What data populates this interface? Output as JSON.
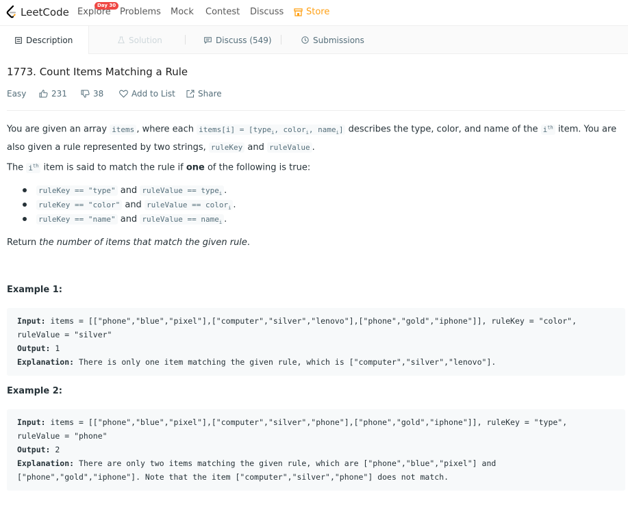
{
  "nav": {
    "logo": "LeetCode",
    "explore": "Explore",
    "badge": "Day 30",
    "problems": "Problems",
    "mock": "Mock",
    "contest": "Contest",
    "discuss": "Discuss",
    "store": "Store",
    "accent": "#ffa116"
  },
  "tabs": {
    "description": "Description",
    "solution": "Solution",
    "discuss": "Discuss (549)",
    "submissions": "Submissions"
  },
  "problem": {
    "title": "1773. Count Items Matching a Rule",
    "difficulty": "Easy",
    "likes": "231",
    "dislikes": "38",
    "add_to_list": "Add to List",
    "share": "Share"
  },
  "description": {
    "p1_a": "You are given an array ",
    "p1_items": "items",
    "p1_b": ", where each ",
    "p1_code1": "items[i] = [type",
    "p1_sub_i1": "i",
    "p1_code2": ", color",
    "p1_sub_i2": "i",
    "p1_code3": ", name",
    "p1_sub_i3": "i",
    "p1_code4": "]",
    "p1_c": " describes the type, color, and name of the ",
    "p1_i": "i",
    "p1_th": "th",
    "p1_d": " item. You are also given a rule represented by two strings, ",
    "p1_rulekey": "ruleKey",
    "p1_and": " and ",
    "p1_rulevalue": "ruleValue",
    "p1_end": ".",
    "p2_a": "The ",
    "p2_i": "i",
    "p2_th": "th",
    "p2_b": " item is said to match the rule if ",
    "p2_one": "one",
    "p2_c": " of the following is true:",
    "rules": [
      {
        "left": "ruleKey == \"type\"",
        "and": " and ",
        "right": "ruleValue == type",
        "sub": "i",
        "end": "."
      },
      {
        "left": "ruleKey == \"color\"",
        "and": " and ",
        "right": "ruleValue == color",
        "sub": "i",
        "end": "."
      },
      {
        "left": "ruleKey == \"name\"",
        "and": " and ",
        "right": "ruleValue == name",
        "sub": "i",
        "end": "."
      }
    ],
    "p3_a": "Return ",
    "p3_em": "the number of items that match the given rule",
    "p3_end": "."
  },
  "examples": [
    {
      "title": "Example 1:",
      "input_label": "Input:",
      "input": " items = [[\"phone\",\"blue\",\"pixel\"],[\"computer\",\"silver\",\"lenovo\"],[\"phone\",\"gold\",\"iphone\"]], ruleKey = \"color\",\nruleValue = \"silver\"",
      "output_label": "Output:",
      "output": " 1",
      "explanation_label": "Explanation:",
      "explanation": " There is only one item matching the given rule, which is [\"computer\",\"silver\",\"lenovo\"]."
    },
    {
      "title": "Example 2:",
      "input_label": "Input:",
      "input": " items = [[\"phone\",\"blue\",\"pixel\"],[\"computer\",\"silver\",\"phone\"],[\"phone\",\"gold\",\"iphone\"]], ruleKey = \"type\",\nruleValue = \"phone\"",
      "output_label": "Output:",
      "output": " 2",
      "explanation_label": "Explanation:",
      "explanation": " There are only two items matching the given rule, which are [\"phone\",\"blue\",\"pixel\"] and\n[\"phone\",\"gold\",\"iphone\"]. Note that the item [\"computer\",\"silver\",\"phone\"] does not match."
    }
  ]
}
